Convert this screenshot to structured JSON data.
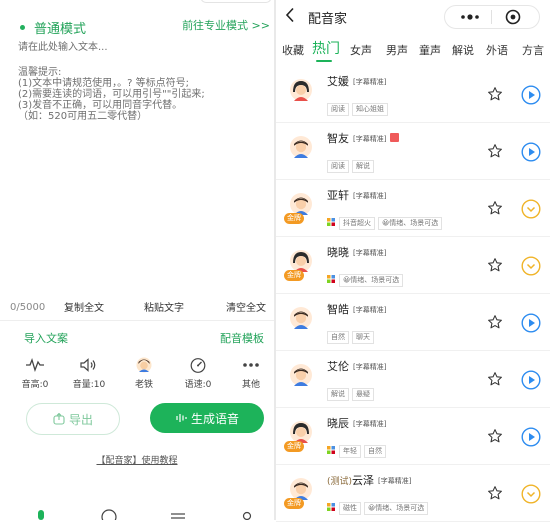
{
  "left": {
    "mode_label": "普通模式",
    "pro_link": "前往专业模式 >>",
    "placeholder": "请在此处输入文本...",
    "tips_title": "温馨提示:",
    "tips": [
      "(1)文本中请规范使用，。? 等标点符号;",
      "(2)需要连读的词语，可以用引号\"\"引起来;",
      "(3)发音不正确，可以用同音字代替。",
      "（如：520可用五二零代替）"
    ],
    "counter": "0/5000",
    "actions": [
      "复制全文",
      "粘贴文字",
      "清空全文"
    ],
    "import_label": "导入文案",
    "template_label": "配音模板",
    "controls": [
      {
        "icon": "pitch-icon",
        "label": "音高:0"
      },
      {
        "icon": "volume-icon",
        "label": "音量:10"
      },
      {
        "icon": "voice-avatar-icon",
        "label": "老铁"
      },
      {
        "icon": "speed-gauge-icon",
        "label": "语速:0"
      },
      {
        "icon": "more-icon",
        "label": "其他"
      }
    ],
    "export_label": "导出",
    "generate_label": "生成语音",
    "tutorial_label": "【配音家】使用教程"
  },
  "right": {
    "title": "配音家",
    "tabs": [
      "收藏",
      "热门",
      "女声",
      "男声",
      "童声",
      "解说",
      "外语",
      "方言"
    ],
    "active_tab": 1,
    "gold_badge": "金牌",
    "voices": [
      {
        "prefix": "",
        "name": "艾媛",
        "subtitle": "[字幕精准]",
        "red_badge": false,
        "gold": false,
        "grid": false,
        "emoji": false,
        "tags": [
          "阅读",
          "知心姐姐"
        ],
        "avatar": "female",
        "play": "play"
      },
      {
        "prefix": "",
        "name": "智友",
        "subtitle": "[字幕精准]",
        "red_badge": true,
        "gold": false,
        "grid": false,
        "emoji": false,
        "tags": [
          "阅读",
          "解说"
        ],
        "avatar": "male",
        "play": "play"
      },
      {
        "prefix": "",
        "name": "亚轩",
        "subtitle": "[字幕精准]",
        "red_badge": false,
        "gold": true,
        "grid": true,
        "emoji": false,
        "tags": [
          "抖音超火",
          "😀情绪、场景可选"
        ],
        "avatar": "male",
        "play": "expand"
      },
      {
        "prefix": "",
        "name": "晓晓",
        "subtitle": "[字幕精准]",
        "red_badge": false,
        "gold": true,
        "grid": true,
        "emoji": false,
        "tags": [
          "😀情绪、场景可选"
        ],
        "avatar": "female",
        "play": "expand"
      },
      {
        "prefix": "",
        "name": "智皓",
        "subtitle": "[字幕精准]",
        "red_badge": false,
        "gold": false,
        "grid": false,
        "emoji": false,
        "tags": [
          "自然",
          "聊天"
        ],
        "avatar": "male",
        "play": "play"
      },
      {
        "prefix": "",
        "name": "艾伦",
        "subtitle": "[字幕精准]",
        "red_badge": false,
        "gold": false,
        "grid": false,
        "emoji": false,
        "tags": [
          "解说",
          "悬疑"
        ],
        "avatar": "male",
        "play": "play"
      },
      {
        "prefix": "",
        "name": "晓辰",
        "subtitle": "[字幕精准]",
        "red_badge": false,
        "gold": true,
        "grid": true,
        "emoji": false,
        "tags": [
          "年轻",
          "自然"
        ],
        "avatar": "female",
        "play": "play"
      },
      {
        "prefix": "(测试)",
        "name": "云泽",
        "subtitle": "[字幕精准]",
        "red_badge": false,
        "gold": true,
        "grid": true,
        "emoji": false,
        "tags": [
          "磁性",
          "😀情绪、场景可选"
        ],
        "avatar": "male",
        "play": "expand"
      }
    ]
  },
  "colors": {
    "accent": "#1db35a",
    "gold": "#f39a23",
    "play_blue": "#2d8cf0",
    "expand_yellow": "#f0b429"
  }
}
